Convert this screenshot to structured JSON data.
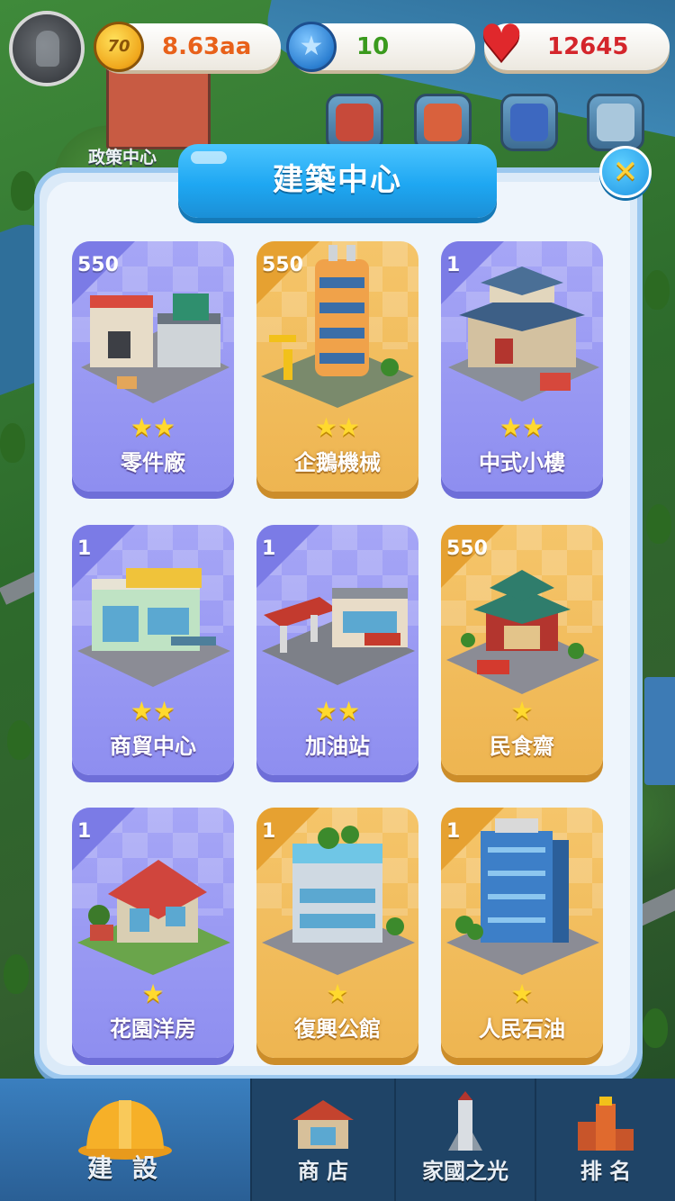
{
  "hud": {
    "coins": "8.63aa",
    "coin_icon_text": "70",
    "stars": "10",
    "hearts": "12645"
  },
  "background": {
    "building_label": "政策中心"
  },
  "events": [
    {
      "name": "event-70-icon",
      "color": "#c74a3a"
    },
    {
      "name": "event-handshake-icon",
      "color": "#d9613d"
    },
    {
      "name": "event-rocket-icon",
      "color": "#3d68c0"
    },
    {
      "name": "event-factory-icon",
      "color": "#7aa9c8"
    }
  ],
  "modal": {
    "title": "建築中心",
    "close_icon": "close-icon"
  },
  "cards": [
    {
      "cost": "550",
      "name": "零件廠",
      "stars": "★★",
      "theme": "purple"
    },
    {
      "cost": "550",
      "name": "企鵝機械",
      "stars": "★★",
      "theme": "orange"
    },
    {
      "cost": "1",
      "name": "中式小樓",
      "stars": "★★",
      "theme": "purple"
    },
    {
      "cost": "1",
      "name": "商貿中心",
      "stars": "★★",
      "theme": "purple"
    },
    {
      "cost": "1",
      "name": "加油站",
      "stars": "★★",
      "theme": "purple"
    },
    {
      "cost": "550",
      "name": "民食齋",
      "stars": "★",
      "theme": "orange"
    },
    {
      "cost": "1",
      "name": "花園洋房",
      "stars": "★",
      "theme": "purple"
    },
    {
      "cost": "1",
      "name": "復興公館",
      "stars": "★",
      "theme": "orange"
    },
    {
      "cost": "1",
      "name": "人民石油",
      "stars": "★",
      "theme": "orange"
    }
  ],
  "nav": {
    "build": "建 設",
    "shop": "商 店",
    "home_light": "家國之光",
    "rank": "排 名"
  },
  "colors": {
    "purple_card": "#9a9af3",
    "orange_card": "#f1bc5d",
    "title_blue": "#1ea7f2",
    "nav_bg": "#1f4467"
  }
}
